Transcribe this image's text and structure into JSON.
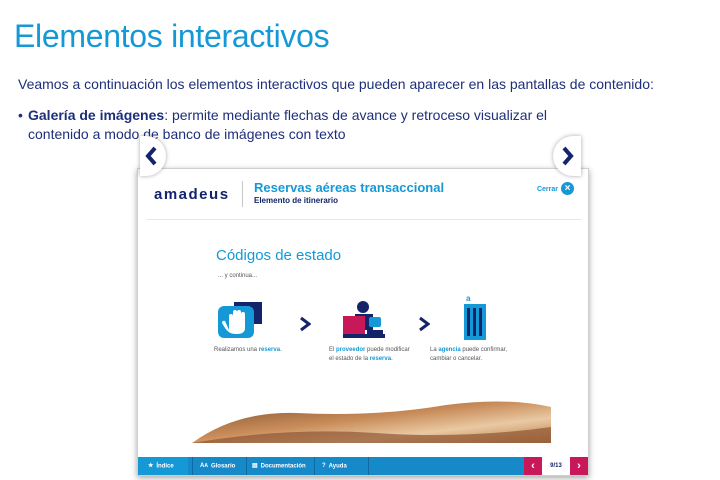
{
  "slide": {
    "title": "Elementos interactivos",
    "intro": "Veamos a continuación los elementos interactivos que pueden aparecer en las pantallas de contenido:",
    "bullet": {
      "marker": "•",
      "term": "Galería de imágenes",
      "text_line1": ": permite mediante flechas de avance y retroceso visualizar el",
      "text_line2": "contenido a modo de banco de imágenes con texto"
    }
  },
  "app": {
    "logo": "amadeus",
    "title": "Reservas aéreas transaccional",
    "subtitle": "Elemento de itinerario",
    "close_label": "Cerrar",
    "close_icon": "×"
  },
  "stage": {
    "title": "Códigos de estado",
    "subtitle": "... y continua...",
    "steps": [
      {
        "icon": "hand-stop-icon",
        "pre": "Realizamos una ",
        "bold": "reserva",
        "post": "."
      },
      {
        "icon": "agent-desk-icon",
        "pre": "El ",
        "bold": "proveedor",
        "post": " puede modificar",
        "line2_pre": "el estado de la ",
        "line2_bold": "reserva",
        "line2_post": "."
      },
      {
        "icon": "building-icon",
        "pre": "La ",
        "bold": "agencia",
        "post": " puede confirmar,",
        "line2_pre": "cambiar o cancelar.",
        "line2_bold": "",
        "line2_post": ""
      }
    ]
  },
  "toolbar": {
    "index": "Índice",
    "glossary": "Glosario",
    "docs": "Documentación",
    "help": "Ayuda"
  },
  "pager": {
    "current": "9/13",
    "prev": "‹",
    "next": "›"
  },
  "colors": {
    "accent": "#1599d6",
    "navy": "#14246b",
    "toolbar": "#1689c9",
    "pager": "#c8185a"
  }
}
